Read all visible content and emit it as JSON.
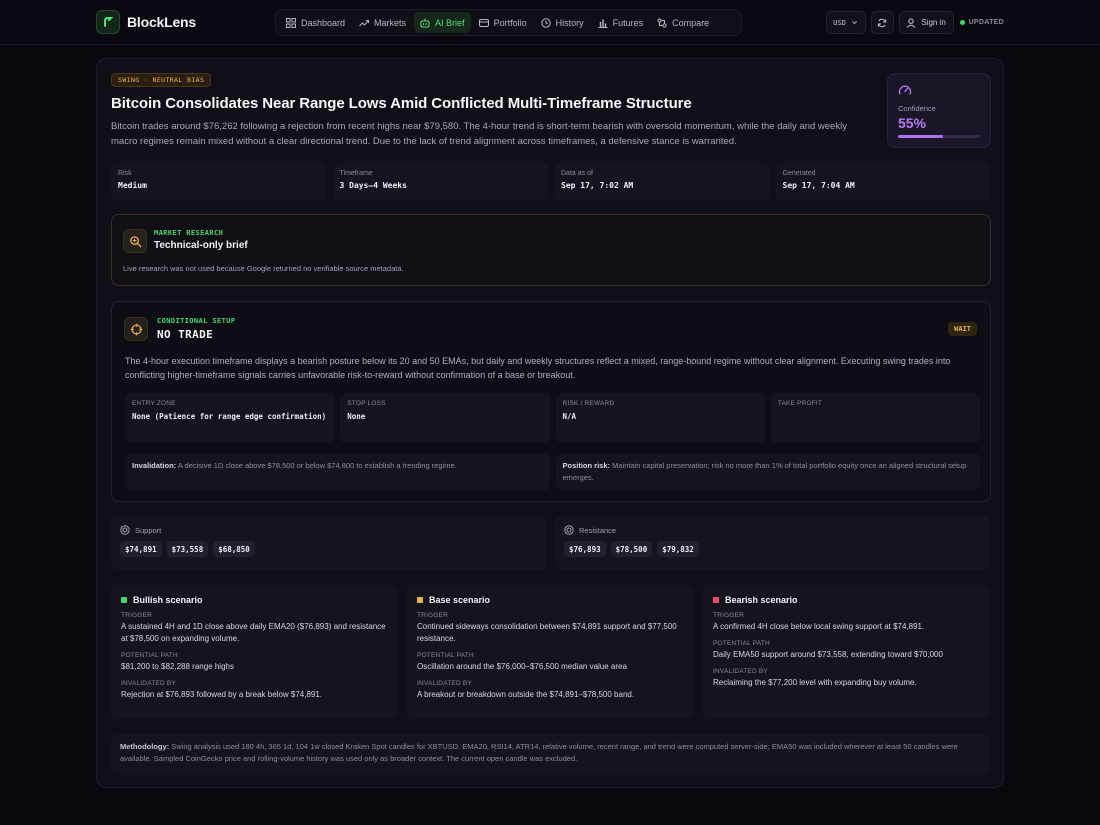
{
  "app": {
    "name": "BlockLens"
  },
  "nav": {
    "items": [
      {
        "label": "Dashboard",
        "icon": "grid-icon",
        "active": false
      },
      {
        "label": "Markets",
        "icon": "trend-icon",
        "active": false
      },
      {
        "label": "AI Brief",
        "icon": "bot-icon",
        "active": true
      },
      {
        "label": "Portfolio",
        "icon": "wallet-icon",
        "active": false
      },
      {
        "label": "History",
        "icon": "clock-icon",
        "active": false
      },
      {
        "label": "Futures",
        "icon": "bars-icon",
        "active": false
      },
      {
        "label": "Compare",
        "icon": "swap-icon",
        "active": false
      }
    ]
  },
  "toolbar": {
    "currency": "USD",
    "signin_label": "Sign in",
    "status": "UPDATED"
  },
  "brief": {
    "bias_tag": "SWING · NEUTRAL BIAS",
    "headline": "Bitcoin Consolidates Near Range Lows Amid Conflicted Multi-Timeframe Structure",
    "summary": "Bitcoin trades around $76,262 following a rejection from recent highs near $79,580. The 4-hour trend is short-term bearish with oversold momentum, while the daily and weekly macro regimes remain mixed without a clear directional trend. Due to the lack of trend alignment across timeframes, a defensive stance is warranted.",
    "confidence_label": "Confidence",
    "confidence_value": "55%",
    "confidence_fraction": 0.55,
    "meta": [
      {
        "key": "Risk",
        "value": "Medium"
      },
      {
        "key": "Timeframe",
        "value": "3 Days–4 Weeks"
      },
      {
        "key": "Data as of",
        "value": "Sep 17, 7:02 AM"
      },
      {
        "key": "Generated",
        "value": "Sep 17, 7:04 AM"
      }
    ]
  },
  "research": {
    "eyebrow": "MARKET RESEARCH",
    "title": "Technical-only brief",
    "note": "Live research was not used because Google returned no verifiable source metadata."
  },
  "setup": {
    "eyebrow": "CONDITIONAL SETUP",
    "title": "NO TRADE",
    "badge": "WAIT",
    "description": "The 4-hour execution timeframe displays a bearish posture below its 20 and 50 EMAs, but daily and weekly structures reflect a mixed, range-bound regime without clear alignment. Executing swing trades into conflicting higher-timeframe signals carries unfavorable risk-to-reward without confirmation of a base or breakout.",
    "params": [
      {
        "key": "ENTRY ZONE",
        "value": "None (Patience for range edge confirmation)"
      },
      {
        "key": "STOP LOSS",
        "value": "None"
      },
      {
        "key": "RISK / REWARD",
        "value": "N/A"
      },
      {
        "key": "TAKE PROFIT",
        "value": ""
      }
    ],
    "invalidation_label": "Invalidation:",
    "invalidation_text": "A decisive 1D close above $78,500 or below $74,800 to establish a trending regime.",
    "position_risk_label": "Position risk:",
    "position_risk_text": "Maintain capital preservation; risk no more than 1% of total portfolio equity once an aligned structural setup emerges."
  },
  "levels": {
    "support": {
      "label": "Support",
      "values": [
        "$74,891",
        "$73,558",
        "$68,850"
      ]
    },
    "resistance": {
      "label": "Resistance",
      "values": [
        "$76,893",
        "$78,500",
        "$79,832"
      ]
    }
  },
  "scenarios": [
    {
      "title": "Bullish scenario",
      "color": "#3fdc6c",
      "trigger_label": "TRIGGER",
      "trigger": "A sustained 4H and 1D close above daily EMA20 ($76,893) and resistance at $78,500 on expanding volume.",
      "path_label": "POTENTIAL PATH",
      "path": "$81,200 to $82,288 range highs",
      "invalid_label": "INVALIDATED BY",
      "invalid": "Rejection at $76,893 followed by a break below $74,891."
    },
    {
      "title": "Base scenario",
      "color": "#f0b04a",
      "trigger_label": "TRIGGER",
      "trigger": "Continued sideways consolidation between $74,891 support and $77,500 resistance.",
      "path_label": "POTENTIAL PATH",
      "path": "Oscillation around the $76,000–$76,500 median value area",
      "invalid_label": "INVALIDATED BY",
      "invalid": "A breakout or breakdown outside the $74,891–$78,500 band."
    },
    {
      "title": "Bearish scenario",
      "color": "#f04a6a",
      "trigger_label": "TRIGGER",
      "trigger": "A confirmed 4H close below local swing support at $74,891.",
      "path_label": "POTENTIAL PATH",
      "path": "Daily EMA50 support around $73,558, extending toward $70,000",
      "invalid_label": "INVALIDATED BY",
      "invalid": "Reclaiming the $77,200 level with expanding buy volume."
    }
  ],
  "methodology": {
    "label": "Methodology:",
    "text": "Swing analysis used 180 4h, 365 1d, 104 1w closed Kraken Spot candles for XBTUSD. EMA20, RSI14, ATR14, relative volume, recent range, and trend were computed server-side; EMA50 was included wherever at least 50 candles were available. Sampled CoinGecko price and rolling-volume history was used only as broader context. The current open candle was excluded."
  },
  "colors": {
    "accent_green": "#45d86e",
    "accent_amber": "#f0b04a",
    "accent_purple": "#b57af5"
  }
}
